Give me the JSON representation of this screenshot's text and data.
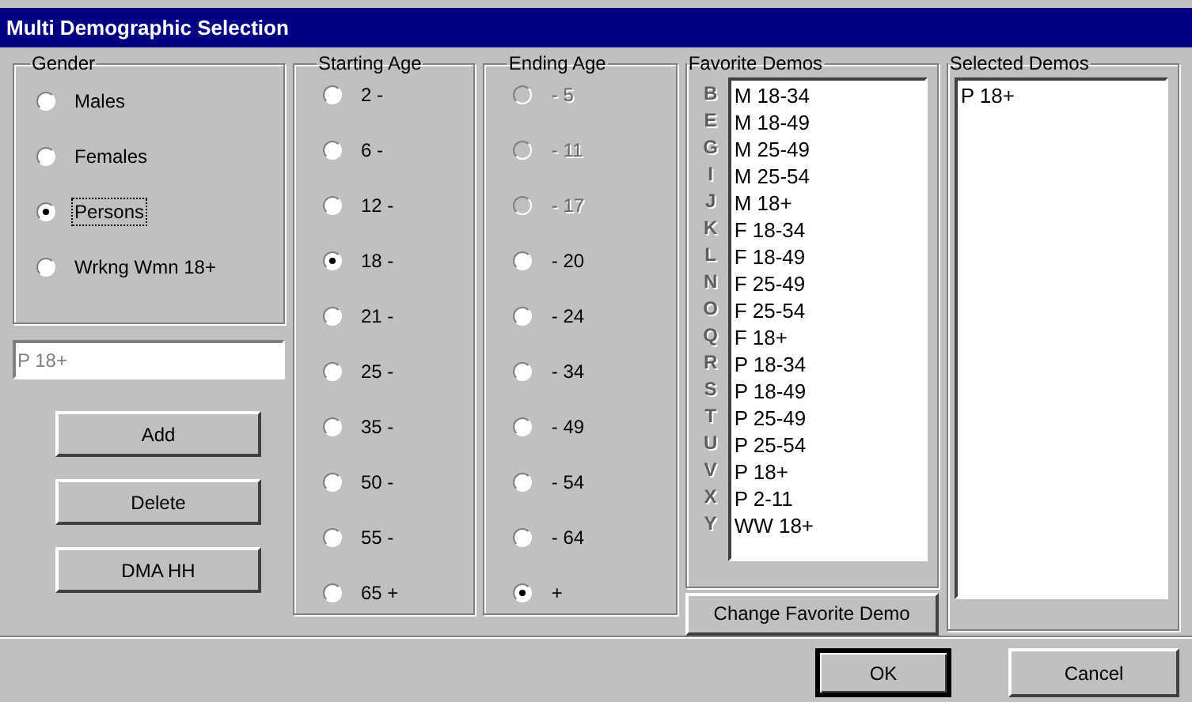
{
  "window": {
    "title": "Multi Demographic Selection"
  },
  "gender": {
    "title": "Gender",
    "options": [
      {
        "label": "Males",
        "selected": false
      },
      {
        "label": "Females",
        "selected": false
      },
      {
        "label": "Persons",
        "selected": true,
        "focused": true
      },
      {
        "label": "Wrkng Wmn 18+",
        "selected": false
      }
    ]
  },
  "demo_field": {
    "value": "P 18+"
  },
  "action_buttons": [
    {
      "label": "Add"
    },
    {
      "label": "Delete"
    },
    {
      "label": "DMA HH"
    }
  ],
  "starting_age": {
    "title": "Starting Age",
    "options": [
      {
        "label": "2 -",
        "selected": false,
        "disabled": false
      },
      {
        "label": "6 -",
        "selected": false,
        "disabled": false
      },
      {
        "label": "12 -",
        "selected": false,
        "disabled": false
      },
      {
        "label": "18 -",
        "selected": true,
        "disabled": false
      },
      {
        "label": "21 -",
        "selected": false,
        "disabled": false
      },
      {
        "label": "25 -",
        "selected": false,
        "disabled": false
      },
      {
        "label": "35 -",
        "selected": false,
        "disabled": false
      },
      {
        "label": "50 -",
        "selected": false,
        "disabled": false
      },
      {
        "label": "55 -",
        "selected": false,
        "disabled": false
      },
      {
        "label": "65 +",
        "selected": false,
        "disabled": false
      }
    ]
  },
  "ending_age": {
    "title": "Ending Age",
    "options": [
      {
        "label": "- 5",
        "selected": false,
        "disabled": true
      },
      {
        "label": "- 11",
        "selected": false,
        "disabled": true
      },
      {
        "label": "- 17",
        "selected": false,
        "disabled": true
      },
      {
        "label": "- 20",
        "selected": false,
        "disabled": false
      },
      {
        "label": "- 24",
        "selected": false,
        "disabled": false
      },
      {
        "label": "- 34",
        "selected": false,
        "disabled": false
      },
      {
        "label": "- 49",
        "selected": false,
        "disabled": false
      },
      {
        "label": "- 54",
        "selected": false,
        "disabled": false
      },
      {
        "label": "- 64",
        "selected": false,
        "disabled": false
      },
      {
        "label": "+",
        "selected": true,
        "disabled": false
      }
    ]
  },
  "favorite_demos": {
    "title": "Favorite Demos",
    "items": [
      {
        "key": "B",
        "label": "M 18-34"
      },
      {
        "key": "E",
        "label": "M 18-49"
      },
      {
        "key": "G",
        "label": "M 25-49"
      },
      {
        "key": "I",
        "label": "M 25-54"
      },
      {
        "key": "J",
        "label": "M 18+"
      },
      {
        "key": "K",
        "label": "F 18-34"
      },
      {
        "key": "L",
        "label": "F 18-49"
      },
      {
        "key": "N",
        "label": "F 25-49"
      },
      {
        "key": "O",
        "label": "F 25-54"
      },
      {
        "key": "Q",
        "label": "F 18+"
      },
      {
        "key": "R",
        "label": "P 18-34"
      },
      {
        "key": "S",
        "label": "P 18-49"
      },
      {
        "key": "T",
        "label": "P 25-49"
      },
      {
        "key": "U",
        "label": "P 25-54"
      },
      {
        "key": "V",
        "label": "P 18+"
      },
      {
        "key": "X",
        "label": "P 2-11"
      },
      {
        "key": "Y",
        "label": "WW 18+"
      }
    ],
    "button": {
      "label": "Change Favorite Demo"
    }
  },
  "selected_demos": {
    "title": "Selected Demos",
    "items": [
      "P 18+"
    ]
  },
  "footer_buttons": [
    {
      "label": "OK",
      "default": true
    },
    {
      "label": "Cancel",
      "default": false
    }
  ]
}
